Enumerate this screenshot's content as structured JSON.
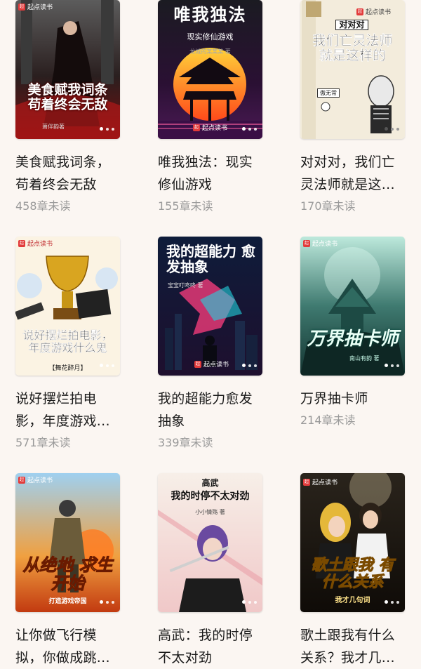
{
  "books": [
    {
      "title": "美食赋我词条，苟着终会无敌",
      "unread": "458章未读",
      "cover_title": "美食赋我词条 苟着终会无敌",
      "cover_author": "萧伴韵著",
      "badge": "起点读书"
    },
    {
      "title": "唯我独法：现实修仙游戏",
      "unread": "155章未读",
      "cover_title": "唯我独法",
      "cover_subtitle": "现实修仙游戏",
      "cover_author": "龙城的某某某 著",
      "badge": "起点读书"
    },
    {
      "title": "对对对，我们亡灵法师就是这...",
      "unread": "170章未读",
      "cover_title": "我们亡灵法师 就是这样的",
      "cover_kicker": "对对对",
      "cover_author": "傲无常",
      "badge": "起点读书"
    },
    {
      "title": "说好摆烂拍电影，年度游戏...",
      "unread": "571章未读",
      "cover_title": "说好摆烂拍电影， 年度游戏什么鬼",
      "cover_author": "【舞花醉月】",
      "badge": "起点读书"
    },
    {
      "title": "我的超能力愈发抽象",
      "unread": "339章未读",
      "cover_title": "我的超能力 愈发抽象",
      "cover_author": "宝宝叮咚咚 著",
      "badge": "起点读书"
    },
    {
      "title": "万界抽卡师",
      "unread": "214章未读",
      "cover_title": "万界抽卡师",
      "cover_author": "南山有韵 著",
      "badge": "起点读书"
    },
    {
      "title": "让你做飞行模拟，你做成跳...",
      "unread": "",
      "cover_title": "从绝地 求生开始",
      "cover_subtitle": "打造游戏帝国",
      "badge": "起点读书"
    },
    {
      "title": "高武：我的时停不太对劲",
      "unread": "",
      "cover_kicker": "高武",
      "cover_title": "我的时停不太对劲",
      "cover_author": "小小情殇 著",
      "badge": "起点读书"
    },
    {
      "title": "歌土跟我有什么关系？我才几...",
      "unread": "",
      "cover_title": "歌土跟我 有什么关系",
      "cover_subtitle": "我才几句词",
      "badge": "起点读书"
    }
  ]
}
